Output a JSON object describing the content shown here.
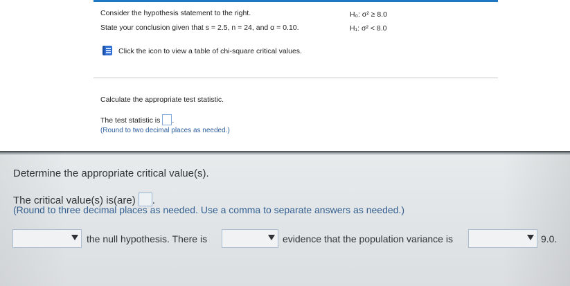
{
  "question": {
    "line1": "Consider the hypothesis statement to the right.",
    "line2": "State your conclusion given that s = 2.5, n = 24, and α = 0.10.",
    "icon_link": "Click the icon to view a table of chi-square critical values."
  },
  "hypotheses": {
    "h0": "H₀: σ² ≥ 8.0",
    "h1": "H₁: σ² < 8.0"
  },
  "test_statistic": {
    "heading": "Calculate the appropriate test statistic.",
    "label": "The test statistic is",
    "suffix": ".",
    "value": "",
    "note": "(Round to two decimal places as needed.)"
  },
  "critical": {
    "heading": "Determine the appropriate critical value(s).",
    "label": "The critical value(s) is(are)",
    "suffix": ".",
    "value": "",
    "note": "(Round to three decimal places as needed. Use a comma to separate answers as needed.)"
  },
  "conclusion": {
    "select1": "",
    "text1": "the null hypothesis. There is",
    "select2": "",
    "text2": "evidence that the population variance is",
    "select3": "",
    "text3": "9.0."
  },
  "colors": {
    "accent": "#1d78c1",
    "note_blue": "#2c5e9e",
    "icon_blue": "#2f6fd1"
  }
}
